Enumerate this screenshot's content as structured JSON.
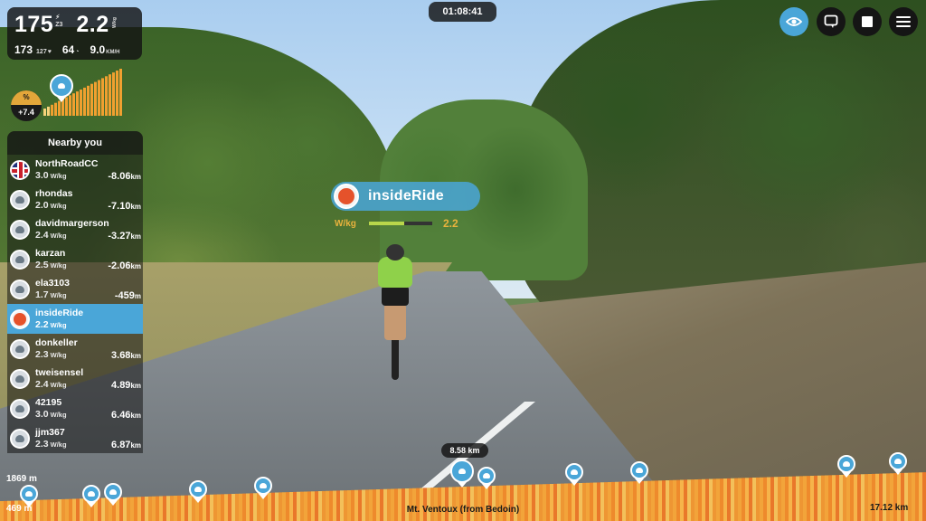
{
  "stats": {
    "power": "175",
    "power_zone": "Z3",
    "wkg": "2.2",
    "wkg_unit": "W/kg",
    "avg_power": "173",
    "heart_rate": "127",
    "cadence": "64",
    "speed": "9.0",
    "speed_unit": "KM/H"
  },
  "timer": "01:08:41",
  "grade": {
    "symbol": "%",
    "value": "+7.4"
  },
  "nearby": {
    "title": "Nearby you",
    "riders": [
      {
        "name": "NorthRoadCC",
        "wkg": "3.0",
        "dist": "-8.06",
        "avatar": "flag-gb-icon"
      },
      {
        "name": "rhondas",
        "wkg": "2.0",
        "dist": "-7.10",
        "avatar": "avatar-icon"
      },
      {
        "name": "davidmargerson",
        "wkg": "2.4",
        "dist": "-3.27",
        "avatar": "avatar-icon"
      },
      {
        "name": "karzan",
        "wkg": "2.5",
        "dist": "-2.06",
        "avatar": "avatar-icon"
      },
      {
        "name": "ela3103",
        "wkg": "1.7",
        "dist": "-459",
        "avatar": "avatar-icon"
      },
      {
        "name": "insideRide",
        "wkg": "2.2",
        "dist": "",
        "avatar": "insideride-logo-icon",
        "me": true
      },
      {
        "name": "donkeller",
        "wkg": "2.3",
        "dist": "3.68",
        "avatar": "avatar-icon"
      },
      {
        "name": "tweisensel",
        "wkg": "2.4",
        "dist": "4.89",
        "avatar": "avatar-icon"
      },
      {
        "name": "42195",
        "wkg": "3.0",
        "dist": "6.46",
        "avatar": "avatar-icon"
      },
      {
        "name": "jjm367",
        "wkg": "2.3",
        "dist": "6.87",
        "avatar": "avatar-icon"
      }
    ],
    "units": {
      "wkg": "W/kg",
      "km": "km",
      "m": "m"
    }
  },
  "bubble": {
    "name": "insideRide",
    "wkg_label": "W/kg",
    "wkg_value": "2.2",
    "wkg_fill": 0.55
  },
  "course": {
    "name": "Mt. Ventoux (from Bedoin)",
    "position": "8.58 km",
    "total": "17.12 km",
    "max_elev": "1869 m",
    "min_elev": "469 m"
  },
  "colors": {
    "accent": "#4aa6d8",
    "grade": "#e3a63a",
    "elevation": "#f0a030"
  }
}
